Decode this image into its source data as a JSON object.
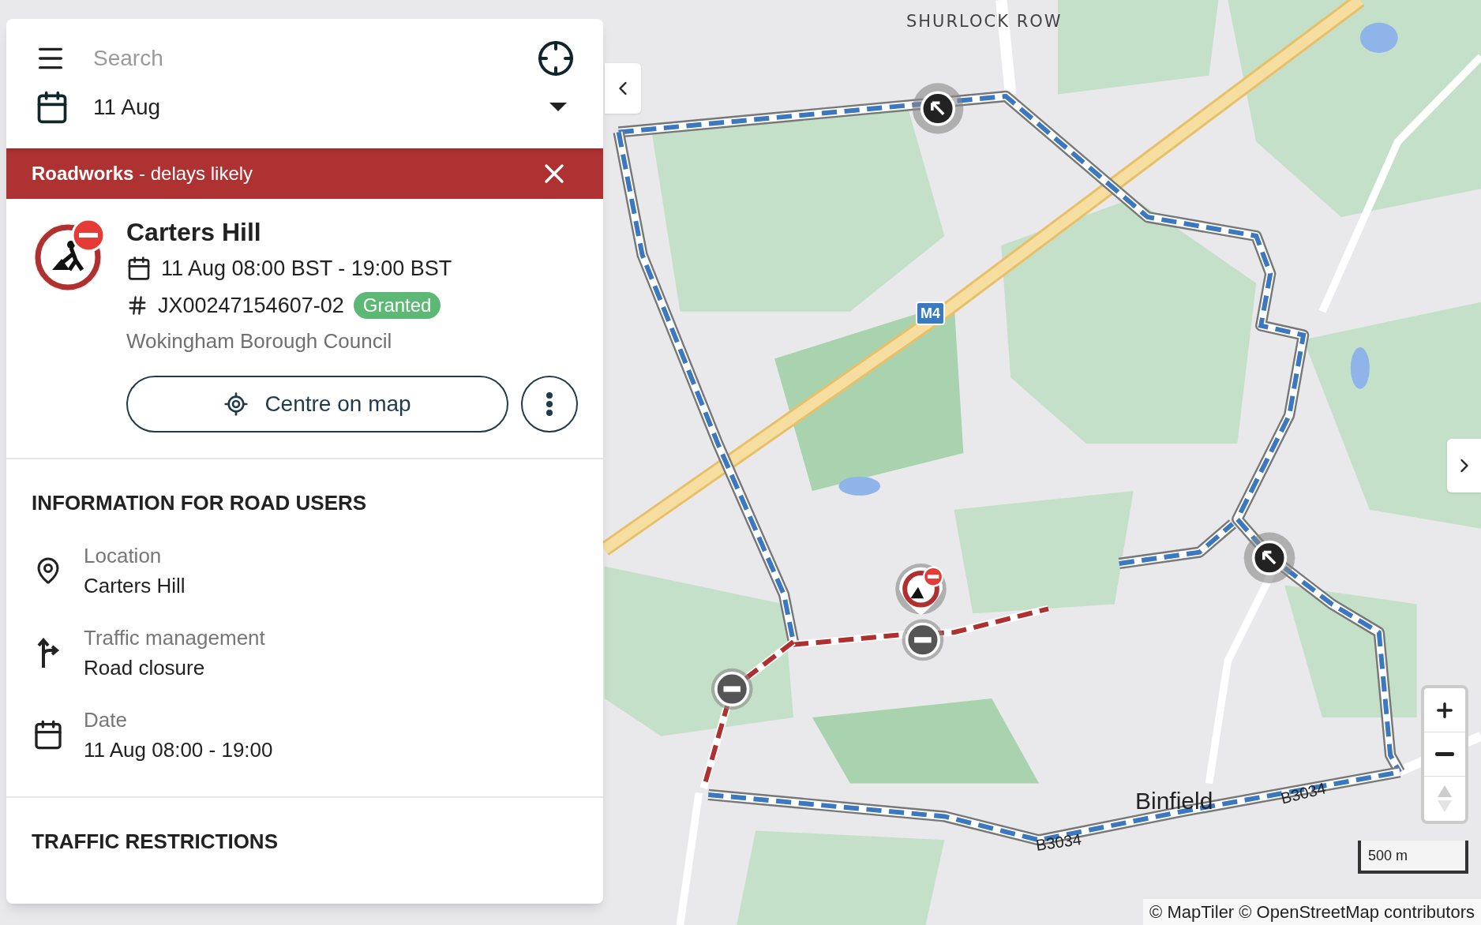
{
  "search": {
    "placeholder": "Search"
  },
  "date_picker": {
    "value": "11 Aug"
  },
  "banner": {
    "text": "**Roadworks** - delays likely"
  },
  "event": {
    "title": "Carters Hill",
    "time": "11 Aug 08:00 BST - 19:00 BST",
    "reference": "JX00247154607-02",
    "status": "Granted",
    "authority": "Wokingham Borough Council",
    "centre_button": "Centre on map"
  },
  "info_section": {
    "heading": "INFORMATION FOR ROAD USERS",
    "items": [
      {
        "kind": "location",
        "label": "Location",
        "value": "Carters Hill"
      },
      {
        "kind": "traffic",
        "label": "Traffic management",
        "value": "Road closure"
      },
      {
        "kind": "date",
        "label": "Date",
        "value": "11 Aug 08:00 - 19:00"
      }
    ]
  },
  "restrictions_section": {
    "heading": "TRAFFIC RESTRICTIONS"
  },
  "map": {
    "labels": [
      {
        "kind": "village",
        "text": "SHURLOCK ROW"
      },
      {
        "kind": "motorway",
        "text": "M4"
      },
      {
        "kind": "town",
        "text": "Binfield"
      },
      {
        "kind": "road",
        "text": "B3034"
      },
      {
        "kind": "road",
        "text": "B3034"
      }
    ],
    "scale": "500 m",
    "attribution": "© MapTiler © OpenStreetMap contributors"
  }
}
